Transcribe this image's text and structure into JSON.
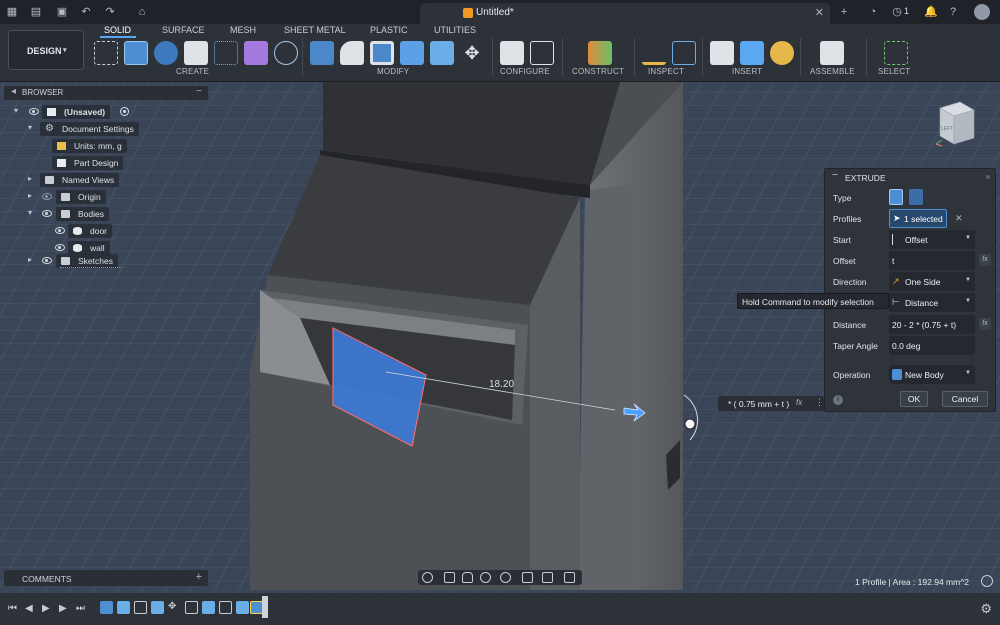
{
  "window": {
    "document_title": "Untitled*",
    "job_count": "1"
  },
  "ribbon": {
    "workspace": "DESIGN",
    "tabs": [
      "SOLID",
      "SURFACE",
      "MESH",
      "SHEET METAL",
      "PLASTIC",
      "UTILITIES"
    ],
    "active_tab": "SOLID",
    "groups": [
      "CREATE",
      "MODIFY",
      "CONFIGURE",
      "CONSTRUCT",
      "INSPECT",
      "INSERT",
      "ASSEMBLE",
      "SELECT"
    ]
  },
  "browser": {
    "title": "BROWSER",
    "items": [
      {
        "label": "(Unsaved)"
      },
      {
        "label": "Document Settings"
      },
      {
        "label": "Units: mm, g"
      },
      {
        "label": "Part Design"
      },
      {
        "label": "Named Views"
      },
      {
        "label": "Origin"
      },
      {
        "label": "Bodies"
      },
      {
        "label": "door"
      },
      {
        "label": "wall"
      },
      {
        "label": "Sketches"
      }
    ]
  },
  "comments": {
    "title": "COMMENTS"
  },
  "extrude_panel": {
    "title": "EXTRUDE",
    "rows": {
      "type": {
        "label": "Type"
      },
      "profiles": {
        "label": "Profiles",
        "value": "1 selected"
      },
      "start": {
        "label": "Start",
        "value": "Offset"
      },
      "offset": {
        "label": "Offset",
        "value": "t"
      },
      "direction": {
        "label": "Direction",
        "value": "One Side"
      },
      "extent": {
        "value": "Distance"
      },
      "distance": {
        "label": "Distance",
        "value": "20 - 2 * (0.75 + t)"
      },
      "taper": {
        "label": "Taper Angle",
        "value": "0.0 deg"
      },
      "operation": {
        "label": "Operation",
        "value": "New Body"
      }
    },
    "ok": "OK",
    "cancel": "Cancel"
  },
  "tooltip": "Hold Command to modify selection",
  "viewport": {
    "dimension_label": "18.20",
    "dimension_input": "* ( 0.75 mm + t )",
    "fx": "fx"
  },
  "viewcube": {
    "face": "LEFT"
  },
  "status": {
    "text": "1 Profile | Area : 192.94 mm^2"
  },
  "colors": {
    "accent": "#4aa0ff",
    "profile_fill": "#3d7ad6",
    "profile_edge": "#ff6e6e",
    "canvas": "#3a4657"
  }
}
